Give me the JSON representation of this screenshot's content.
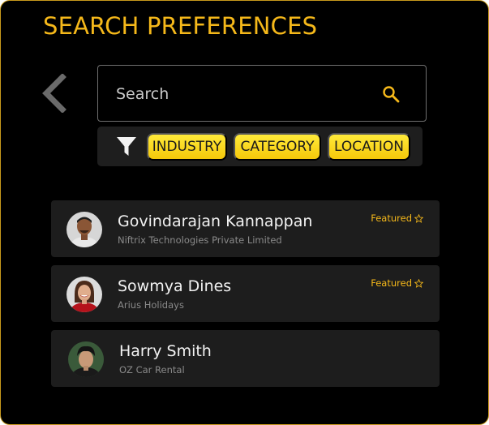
{
  "header": {
    "title": "SEARCH PREFERENCES"
  },
  "search": {
    "placeholder": "Search",
    "value": ""
  },
  "filters": {
    "chips": [
      {
        "label": "INDUSTRY"
      },
      {
        "label": "CATEGORY"
      },
      {
        "label": "LOCATION"
      }
    ]
  },
  "results": [
    {
      "name": "Govindarajan Kannappan",
      "company": "Niftrix Technologies Private Limited",
      "featured_label": "Featured"
    },
    {
      "name": "Sowmya Dines",
      "company": "Arius Holidays",
      "featured_label": "Featured"
    },
    {
      "name": "Harry Smith",
      "company": "OZ Car Rental"
    }
  ],
  "colors": {
    "accent": "#f5b81a",
    "chip": "#f5d20f",
    "background": "#000000",
    "card": "#1d1d1d"
  },
  "icons": [
    "back-chevron-icon",
    "search-icon",
    "filter-icon",
    "star-icon"
  ]
}
